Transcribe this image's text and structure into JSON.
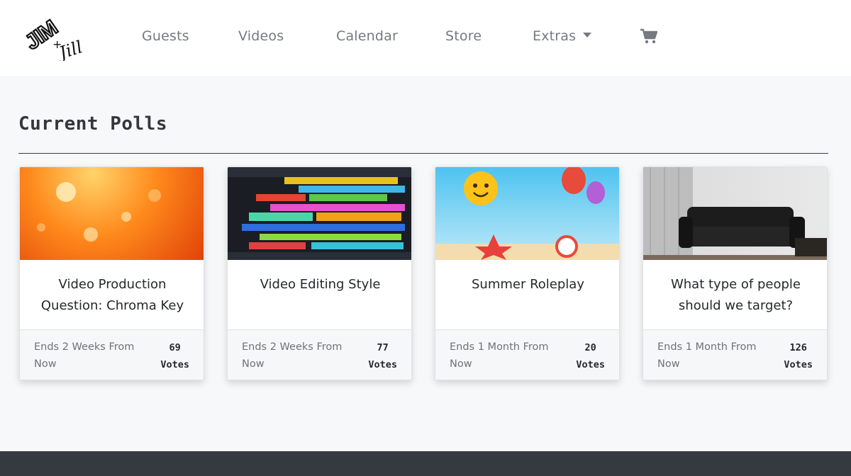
{
  "brand": {
    "logo_text_1": "JIM",
    "logo_plus": "+",
    "logo_text_2": "Jill"
  },
  "nav": {
    "items": [
      {
        "label": "Guests"
      },
      {
        "label": "Videos"
      },
      {
        "label": "Calendar"
      },
      {
        "label": "Store"
      },
      {
        "label": "Extras",
        "has_dropdown": true
      }
    ],
    "cart_icon": "shopping-cart-icon"
  },
  "page": {
    "title": "Current Polls"
  },
  "polls": [
    {
      "title": "Video Production Question: Chroma Key",
      "ends": "Ends 2 Weeks From Now",
      "votes_count": "69",
      "votes_label": "Votes",
      "image": "sun-image"
    },
    {
      "title": "Video Editing Style",
      "ends": "Ends 2 Weeks From Now",
      "votes_count": "77",
      "votes_label": "Votes",
      "image": "editing-timeline-image"
    },
    {
      "title": "Summer Roleplay",
      "ends": "Ends 1 Month From Now",
      "votes_count": "20",
      "votes_label": "Votes",
      "image": "summer-time-image"
    },
    {
      "title": "What type of people should we target?",
      "ends": "Ends 1 Month From Now",
      "votes_count": "126",
      "votes_label": "Votes",
      "image": "couch-room-image"
    }
  ],
  "colors": {
    "nav_text": "#757a80",
    "footer_bg": "#343a40",
    "page_bg": "#f7f8fa"
  }
}
